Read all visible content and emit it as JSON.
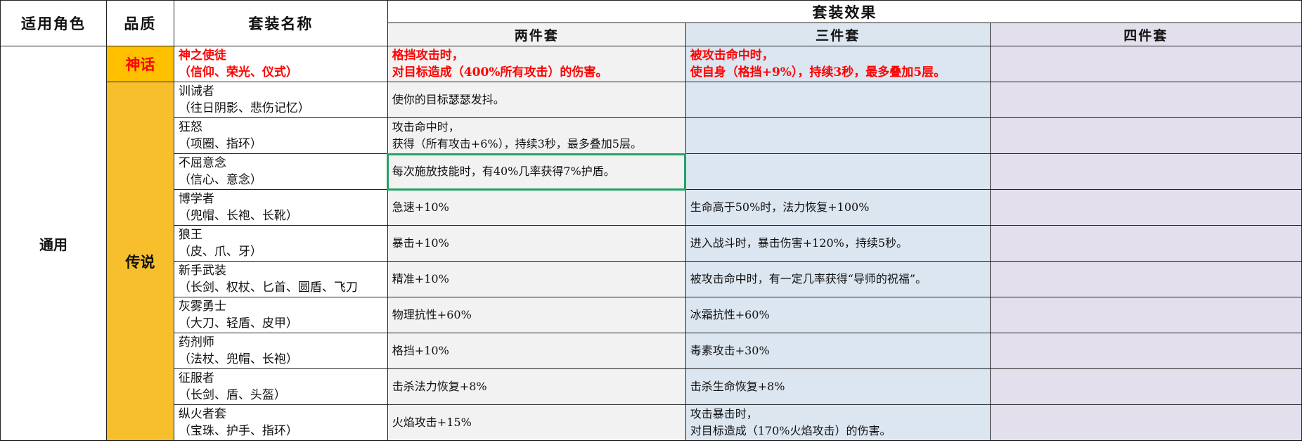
{
  "headers": {
    "role": "适用角色",
    "quality": "品质",
    "set_name": "套装名称",
    "set_effect": "套装效果",
    "two": "两件套",
    "three": "三件套",
    "four": "四件套"
  },
  "role": "通用",
  "quality_myth": "神话",
  "quality_legend": "传说",
  "rows": [
    {
      "name": "神之使徒",
      "parts": "（信仰、荣光、仪式）",
      "two_a": "格挡攻击时，",
      "two_b": "对目标造成（400%所有攻击）的伤害。",
      "three_a": "被攻击命中时，",
      "three_b": "使自身（格挡+9%），持续3秒，最多叠加5层。"
    },
    {
      "name": "训诫者",
      "parts": "（往日阴影、悲伤记忆）",
      "two_a": "使你的目标瑟瑟发抖。",
      "two_b": "",
      "three_a": "",
      "three_b": ""
    },
    {
      "name": "狂怒",
      "parts": "（项圈、指环）",
      "two_a": "攻击命中时，",
      "two_b": "获得（所有攻击+6%），持续3秒，最多叠加5层。",
      "three_a": "",
      "three_b": ""
    },
    {
      "name": "不屈意念",
      "parts": "（信心、意念）",
      "two_a": "每次施放技能时，有40%几率获得7%护盾。",
      "two_b": "",
      "three_a": "",
      "three_b": ""
    },
    {
      "name": "博学者",
      "parts": "（兜帽、长袍、长靴）",
      "two_a": "急速+10%",
      "two_b": "",
      "three_a": "生命高于50%时，法力恢复+100%",
      "three_b": ""
    },
    {
      "name": "狼王",
      "parts": "（皮、爪、牙）",
      "two_a": "暴击+10%",
      "two_b": "",
      "three_a": "进入战斗时，暴击伤害+120%，持续5秒。",
      "three_b": ""
    },
    {
      "name": "新手武装",
      "parts": "（长剑、权杖、匕首、圆盾、飞刀",
      "two_a": "精准+10%",
      "two_b": "",
      "three_a": "被攻击命中时，有一定几率获得“导师的祝福”。",
      "three_b": ""
    },
    {
      "name": "灰雾勇士",
      "parts": "（大刀、轻盾、皮甲）",
      "two_a": "物理抗性+60%",
      "two_b": "",
      "three_a": "冰霜抗性+60%",
      "three_b": ""
    },
    {
      "name": "药剂师",
      "parts": "（法杖、兜帽、长袍）",
      "two_a": "格挡+10%",
      "two_b": "",
      "three_a": "毒素攻击+30%",
      "three_b": ""
    },
    {
      "name": "征服者",
      "parts": "（长剑、盾、头盔）",
      "two_a": "击杀法力恢复+8%",
      "two_b": "",
      "three_a": "击杀生命恢复+8%",
      "three_b": ""
    },
    {
      "name": "纵火者套",
      "parts": "（宝珠、护手、指环）",
      "two_a": "火焰攻击+15%",
      "two_b": "",
      "three_a": "攻击暴击时，",
      "three_b": "对目标造成（170%火焰攻击）的伤害。"
    }
  ],
  "colors": {
    "myth_bg": "#ffc000",
    "legend_bg": "#f8bf2c",
    "two_bg": "#f2f2f2",
    "three_bg": "#dce6f1",
    "four_bg": "#e4dfec",
    "highlight": "#ff0000",
    "selection": "#21a366"
  }
}
